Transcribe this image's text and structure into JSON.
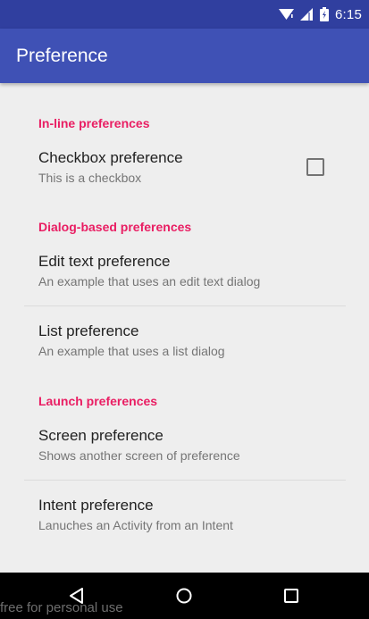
{
  "status_bar": {
    "time": "6:15",
    "icons": [
      "wifi-icon",
      "signal-icon",
      "battery-icon"
    ]
  },
  "app_bar": {
    "title": "Preference"
  },
  "sections": [
    {
      "header": "In-line preferences",
      "items": [
        {
          "title": "Checkbox preference",
          "summary": "This is a checkbox",
          "widget": "checkbox",
          "checked": false
        }
      ]
    },
    {
      "header": "Dialog-based preferences",
      "items": [
        {
          "title": "Edit text preference",
          "summary": "An example that uses an edit text dialog"
        },
        {
          "title": "List preference",
          "summary": "An example that uses a list dialog"
        }
      ]
    },
    {
      "header": "Launch preferences",
      "items": [
        {
          "title": "Screen preference",
          "summary": "Shows another screen of preference"
        },
        {
          "title": "Intent preference",
          "summary": "Lanuches an Activity from an Intent"
        }
      ]
    }
  ],
  "nav_bar": {
    "buttons": [
      "back-icon",
      "home-icon",
      "recents-icon"
    ]
  },
  "watermark": "free for personal use",
  "colors": {
    "status_bar": "#303f9f",
    "app_bar": "#3f51b5",
    "accent": "#e91e63",
    "background": "#eeeeee"
  }
}
